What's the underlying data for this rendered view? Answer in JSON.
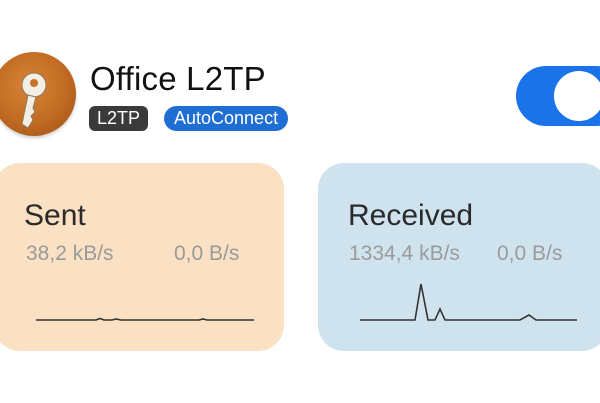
{
  "connection": {
    "name": "Office L2TP",
    "badges": {
      "protocol": "L2TP",
      "mode": "AutoConnect"
    },
    "enabled": true
  },
  "icons": {
    "app": "key-icon"
  },
  "colors": {
    "toggle_on": "#1a73e8",
    "badge_protocol": "#3a3a3a",
    "badge_mode": "#1f6ed4",
    "sent_card": "#fae1c3",
    "received_card": "#cfe3ef"
  },
  "stats": {
    "sent": {
      "label": "Sent",
      "rate_primary": "38,2 kB/s",
      "rate_secondary": "0,0 B/s"
    },
    "received": {
      "label": "Received",
      "rate_primary": "1334,4 kB/s",
      "rate_secondary": "0,0 B/s"
    }
  }
}
